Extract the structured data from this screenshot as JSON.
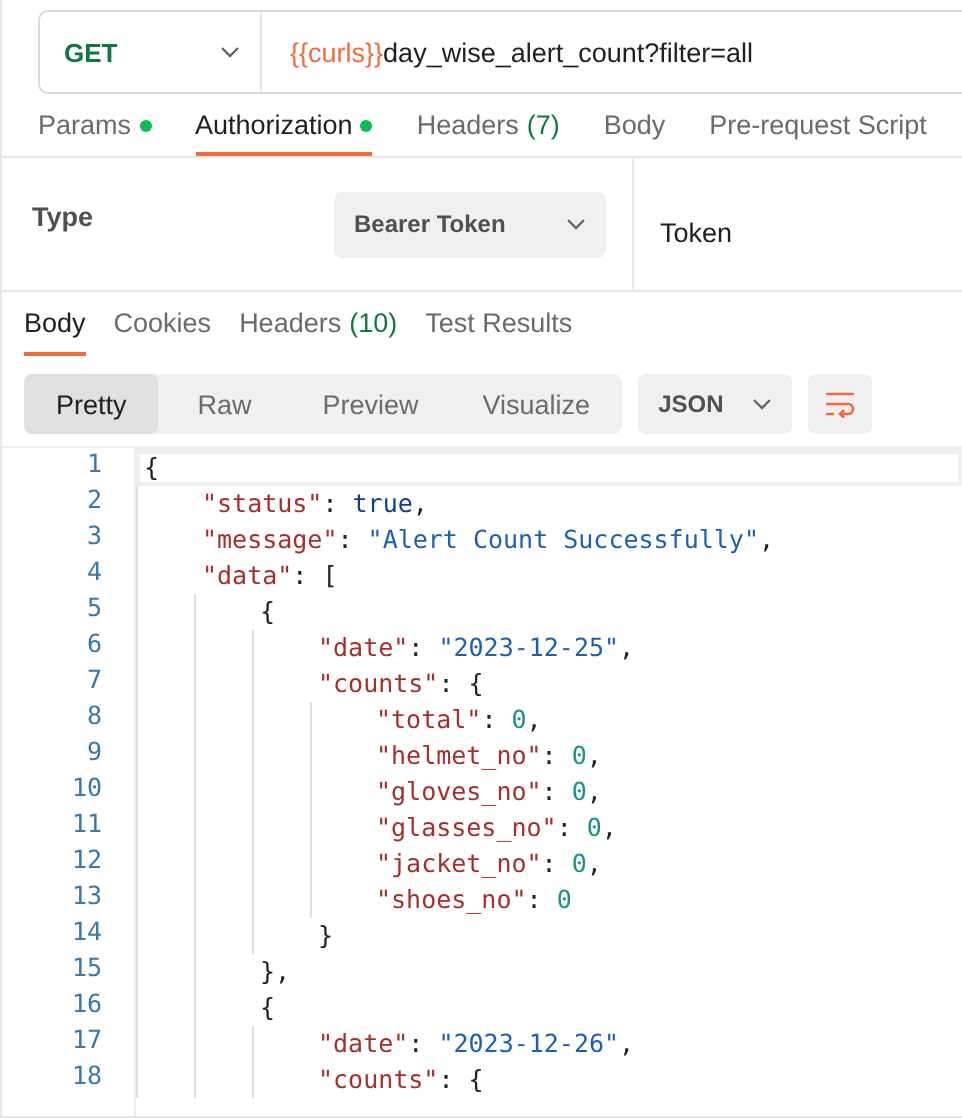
{
  "request": {
    "method": "GET",
    "url_variable": "{{curls}}",
    "url_path": "day_wise_alert_count?filter=all"
  },
  "request_tabs": [
    {
      "label": "Params",
      "dot": true,
      "selected": false
    },
    {
      "label": "Authorization",
      "dot": true,
      "selected": true
    },
    {
      "label": "Headers",
      "count": "(7)",
      "dot": false,
      "selected": false
    },
    {
      "label": "Body",
      "dot": false,
      "selected": false
    },
    {
      "label": "Pre-request Script",
      "dot": false,
      "selected": false
    }
  ],
  "auth": {
    "type_label": "Type",
    "type_value": "Bearer Token",
    "token_label": "Token"
  },
  "response_tabs": [
    {
      "label": "Body",
      "selected": true
    },
    {
      "label": "Cookies",
      "selected": false
    },
    {
      "label": "Headers",
      "count": "(10)",
      "selected": false
    },
    {
      "label": "Test Results",
      "selected": false
    }
  ],
  "view_modes": [
    {
      "label": "Pretty",
      "selected": true
    },
    {
      "label": "Raw",
      "selected": false
    },
    {
      "label": "Preview",
      "selected": false
    },
    {
      "label": "Visualize",
      "selected": false
    }
  ],
  "format": "JSON",
  "code_lines": [
    {
      "number": "1",
      "tokens": [
        {
          "kind": "punct",
          "text": "{"
        }
      ]
    },
    {
      "number": "2",
      "tokens": [
        {
          "kind": "key",
          "text": "\"status\""
        },
        {
          "kind": "punct",
          "text": ": "
        },
        {
          "kind": "bool",
          "text": "true"
        },
        {
          "kind": "punct",
          "text": ","
        }
      ]
    },
    {
      "number": "3",
      "tokens": [
        {
          "kind": "key",
          "text": "\"message\""
        },
        {
          "kind": "punct",
          "text": ": "
        },
        {
          "kind": "string",
          "text": "\"Alert Count Successfully\""
        },
        {
          "kind": "punct",
          "text": ","
        }
      ]
    },
    {
      "number": "4",
      "tokens": [
        {
          "kind": "key",
          "text": "\"data\""
        },
        {
          "kind": "punct",
          "text": ": "
        },
        {
          "kind": "punct",
          "text": "["
        }
      ]
    },
    {
      "number": "5",
      "tokens": [
        {
          "kind": "punct",
          "text": "{"
        }
      ]
    },
    {
      "number": "6",
      "tokens": [
        {
          "kind": "key",
          "text": "\"date\""
        },
        {
          "kind": "punct",
          "text": ": "
        },
        {
          "kind": "string",
          "text": "\"2023-12-25\""
        },
        {
          "kind": "punct",
          "text": ","
        }
      ]
    },
    {
      "number": "7",
      "tokens": [
        {
          "kind": "key",
          "text": "\"counts\""
        },
        {
          "kind": "punct",
          "text": ": "
        },
        {
          "kind": "punct",
          "text": "{"
        }
      ]
    },
    {
      "number": "8",
      "tokens": [
        {
          "kind": "key",
          "text": "\"total\""
        },
        {
          "kind": "punct",
          "text": ": "
        },
        {
          "kind": "number",
          "text": "0"
        },
        {
          "kind": "punct",
          "text": ","
        }
      ]
    },
    {
      "number": "9",
      "tokens": [
        {
          "kind": "key",
          "text": "\"helmet_no\""
        },
        {
          "kind": "punct",
          "text": ": "
        },
        {
          "kind": "number",
          "text": "0"
        },
        {
          "kind": "punct",
          "text": ","
        }
      ]
    },
    {
      "number": "10",
      "tokens": [
        {
          "kind": "key",
          "text": "\"gloves_no\""
        },
        {
          "kind": "punct",
          "text": ": "
        },
        {
          "kind": "number",
          "text": "0"
        },
        {
          "kind": "punct",
          "text": ","
        }
      ]
    },
    {
      "number": "11",
      "tokens": [
        {
          "kind": "key",
          "text": "\"glasses_no\""
        },
        {
          "kind": "punct",
          "text": ": "
        },
        {
          "kind": "number",
          "text": "0"
        },
        {
          "kind": "punct",
          "text": ","
        }
      ]
    },
    {
      "number": "12",
      "tokens": [
        {
          "kind": "key",
          "text": "\"jacket_no\""
        },
        {
          "kind": "punct",
          "text": ": "
        },
        {
          "kind": "number",
          "text": "0"
        },
        {
          "kind": "punct",
          "text": ","
        }
      ]
    },
    {
      "number": "13",
      "tokens": [
        {
          "kind": "key",
          "text": "\"shoes_no\""
        },
        {
          "kind": "punct",
          "text": ": "
        },
        {
          "kind": "number",
          "text": "0"
        }
      ]
    },
    {
      "number": "14",
      "tokens": [
        {
          "kind": "punct",
          "text": "}"
        }
      ]
    },
    {
      "number": "15",
      "tokens": [
        {
          "kind": "punct",
          "text": "},"
        }
      ]
    },
    {
      "number": "16",
      "tokens": [
        {
          "kind": "punct",
          "text": "{"
        }
      ]
    },
    {
      "number": "17",
      "tokens": [
        {
          "kind": "key",
          "text": "\"date\""
        },
        {
          "kind": "punct",
          "text": ": "
        },
        {
          "kind": "string",
          "text": "\"2023-12-26\""
        },
        {
          "kind": "punct",
          "text": ","
        }
      ]
    },
    {
      "number": "18",
      "tokens": [
        {
          "kind": "key",
          "text": "\"counts\""
        },
        {
          "kind": "punct",
          "text": ": "
        },
        {
          "kind": "punct",
          "text": "{"
        }
      ]
    }
  ]
}
